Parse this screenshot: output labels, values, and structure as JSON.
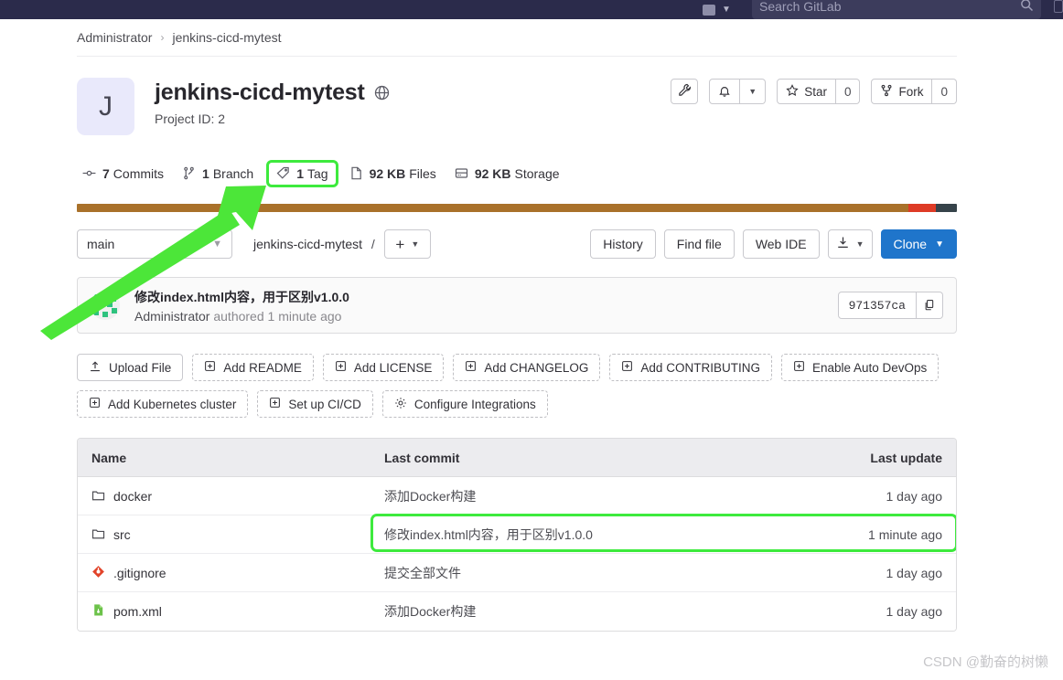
{
  "navbar": {
    "search_placeholder": "Search GitLab",
    "search_icon": "search-icon",
    "menu_icon": "nav-menu-icon",
    "chevron_icon": "chevron-down-icon"
  },
  "breadcrumb": {
    "items": [
      "Administrator",
      "jenkins-cicd-mytest"
    ],
    "separator": "›"
  },
  "project": {
    "avatar_initial": "J",
    "title": "jenkins-cicd-mytest",
    "visibility_icon": "globe-icon",
    "project_id_label": "Project ID: 2",
    "actions": {
      "settings_icon": "wrench-icon",
      "notifications_icon": "bell-icon",
      "notifications_chevron": "chevron-down-icon",
      "star_icon": "star-icon",
      "star_label": "Star",
      "star_count": "0",
      "fork_icon": "fork-icon",
      "fork_label": "Fork",
      "fork_count": "0"
    }
  },
  "stats": [
    {
      "icon": "commit-icon",
      "value": "7",
      "label": "Commits",
      "highlighted": false
    },
    {
      "icon": "branch-icon",
      "value": "1",
      "label": "Branch",
      "highlighted": false
    },
    {
      "icon": "tag-icon",
      "value": "1",
      "label": "Tag",
      "highlighted": true
    },
    {
      "icon": "file-icon",
      "value": "92 KB",
      "label": "Files",
      "highlighted": false
    },
    {
      "icon": "storage-icon",
      "value": "92 KB",
      "label": "Storage",
      "highlighted": false
    }
  ],
  "language_bar": [
    {
      "name": "segment-1",
      "color": "#a9712a",
      "width": "94.5%"
    },
    {
      "name": "segment-2",
      "color": "#de3b26",
      "width": "3.1%"
    },
    {
      "name": "segment-3",
      "color": "#36434a",
      "width": "2.4%"
    }
  ],
  "ref_toolbar": {
    "branch_selected": "main",
    "branch_chevron": "chevron-down-icon",
    "path_root": "jenkins-cicd-mytest",
    "path_slash": "/",
    "add_plus": "+",
    "add_chevron": "chevron-down-icon",
    "history_label": "History",
    "find_file_label": "Find file",
    "web_ide_label": "Web IDE",
    "download_icon": "download-icon",
    "download_chevron": "chevron-down-icon",
    "clone_label": "Clone",
    "clone_chevron": "chevron-down-icon",
    "clone_color": "#1f75cb"
  },
  "last_commit": {
    "avatar": "identicon-avatar",
    "message": "修改index.html内容，用于区别v1.0.0",
    "author": "Administrator",
    "authored_text": "authored 1 minute ago",
    "sha": "971357ca",
    "copy_icon": "copy-icon"
  },
  "quick_actions": {
    "row1": [
      {
        "label": "Upload File",
        "icon": "upload-icon",
        "style": "solid"
      },
      {
        "label": "Add README",
        "icon": "plus-square-icon",
        "style": "dashed"
      },
      {
        "label": "Add LICENSE",
        "icon": "plus-square-icon",
        "style": "dashed"
      },
      {
        "label": "Add CHANGELOG",
        "icon": "plus-square-icon",
        "style": "dashed"
      },
      {
        "label": "Add CONTRIBUTING",
        "icon": "plus-square-icon",
        "style": "dashed"
      },
      {
        "label": "Enable Auto DevOps",
        "icon": "plus-square-icon",
        "style": "dashed"
      }
    ],
    "row2": [
      {
        "label": "Add Kubernetes cluster",
        "icon": "plus-square-icon",
        "style": "dashed"
      },
      {
        "label": "Set up CI/CD",
        "icon": "plus-square-icon",
        "style": "dashed"
      },
      {
        "label": "Configure Integrations",
        "icon": "gear-icon",
        "style": "dashed"
      }
    ]
  },
  "file_table": {
    "headers": {
      "name": "Name",
      "commit": "Last commit",
      "update": "Last update"
    },
    "rows": [
      {
        "icon": "folder-icon",
        "name": "docker",
        "commit": "添加Docker构建",
        "update": "1 day ago",
        "highlighted": false
      },
      {
        "icon": "folder-icon",
        "name": "src",
        "commit": "修改index.html内容，用于区别v1.0.0",
        "update": "1 minute ago",
        "highlighted": true
      },
      {
        "icon": "git-file-icon",
        "name": ".gitignore",
        "commit": "提交全部文件",
        "update": "1 day ago",
        "highlighted": false
      },
      {
        "icon": "xml-file-icon",
        "name": "pom.xml",
        "commit": "添加Docker构建",
        "update": "1 day ago",
        "highlighted": false
      }
    ]
  },
  "annotation": {
    "arrow_color": "#4ce639",
    "arrow_name": "green-annotation-arrow"
  },
  "watermark": {
    "text": "CSDN @勤奋的树懒"
  }
}
